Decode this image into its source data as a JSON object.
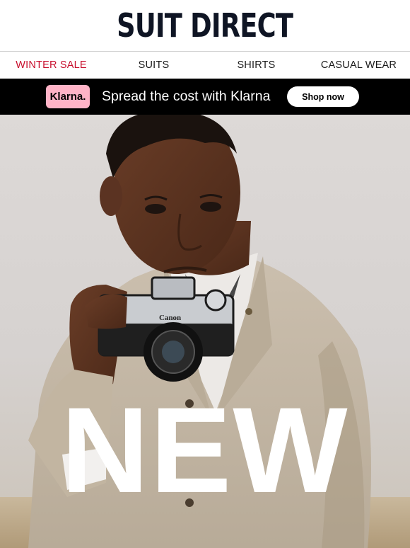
{
  "header": {
    "logo": "SUIT DIRECT"
  },
  "nav": {
    "items": [
      {
        "label": "WINTER SALE",
        "color": "#c8102e"
      },
      {
        "label": "SUITS"
      },
      {
        "label": "SHIRTS"
      },
      {
        "label": "CASUAL WEAR"
      }
    ]
  },
  "promo": {
    "badge": "Klarna.",
    "badge_color": "#ffb3c7",
    "text": "Spread the cost with Klarna",
    "button": "Shop now"
  },
  "hero": {
    "headline": "NEW",
    "camera_brand": "Canon"
  }
}
